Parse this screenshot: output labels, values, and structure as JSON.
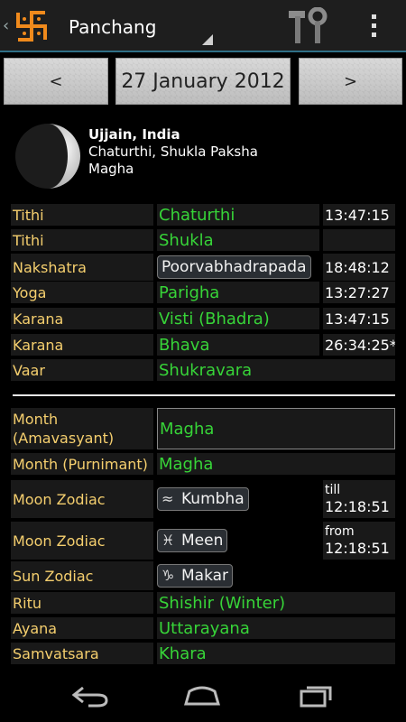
{
  "app": {
    "title": "Panchang"
  },
  "date_nav": {
    "prev_label": "<",
    "date": "27 January 2012",
    "next_label": ">"
  },
  "location": {
    "place": "Ujjain, India",
    "line2": "Chaturthi, Shukla Paksha",
    "line3": "Magha"
  },
  "rows": [
    {
      "label": "Tithi",
      "value": "Chaturthi",
      "time": "13:47:15"
    },
    {
      "label": "Tithi",
      "value": "Shukla",
      "time": ""
    },
    {
      "label": "Nakshatra",
      "value": "Poorvabhadrapada",
      "time": "18:48:12"
    },
    {
      "label": "Yoga",
      "value": "Parigha",
      "time": "13:27:27"
    },
    {
      "label": "Karana",
      "value": "Visti (Bhadra)",
      "time": "13:47:15"
    },
    {
      "label": "Karana",
      "value": "Bhava",
      "time": "26:34:25*"
    },
    {
      "label": "Vaar",
      "value": "Shukravara",
      "time": ""
    }
  ],
  "rows2": [
    {
      "label": "Month (Amavasyant)",
      "value": "Magha"
    },
    {
      "label": "Month (Purnimant)",
      "value": "Magha"
    },
    {
      "label": "Moon Zodiac",
      "value": "Kumbha",
      "glyph": "≈",
      "time_label": "till",
      "time": "12:18:51"
    },
    {
      "label": "Moon Zodiac",
      "value": "Meen",
      "glyph": "♓",
      "time_label": "from",
      "time": "12:18:51"
    },
    {
      "label": "Sun Zodiac",
      "value": "Makar",
      "glyph": "♑"
    },
    {
      "label": "Ritu",
      "value": "Shishir (Winter)"
    },
    {
      "label": "Ayana",
      "value": "Uttarayana"
    },
    {
      "label": "Samvatsara",
      "value": "Khara"
    }
  ],
  "icons": {
    "back": "back-caret-icon",
    "logo": "swastika-logo-icon",
    "tools": "tools-icon",
    "overflow": "overflow-menu-icon",
    "moon": "moon-phase-icon",
    "nav_back": "back-nav-icon",
    "nav_home": "home-nav-icon",
    "nav_recent": "recent-apps-icon"
  },
  "colors": {
    "label": "#f5cf6e",
    "value": "#37d438",
    "accent": "#2f6f86",
    "row_bg": "#191919"
  }
}
